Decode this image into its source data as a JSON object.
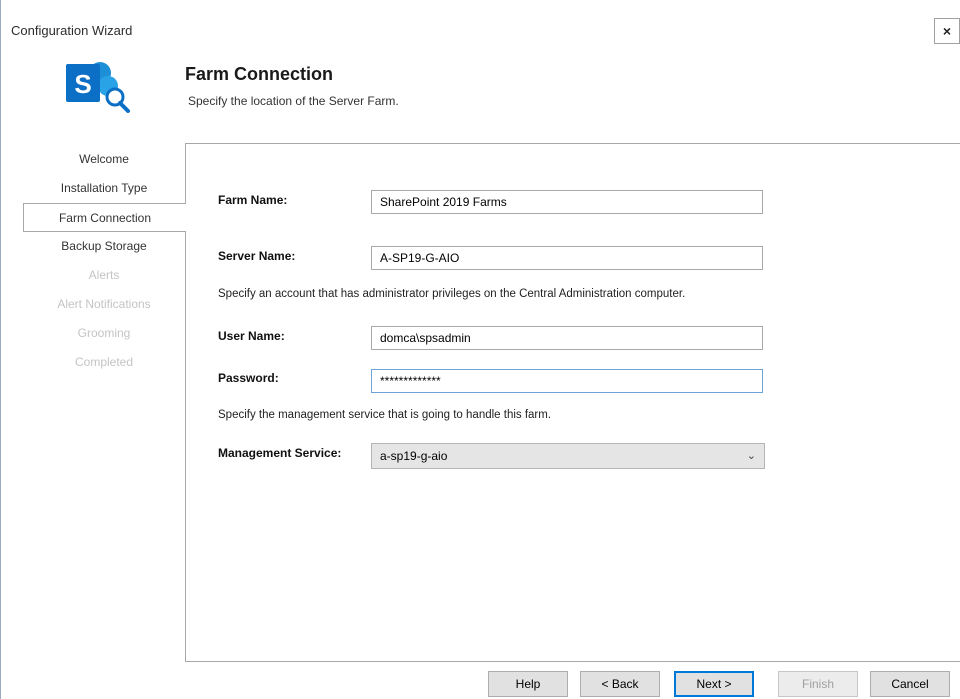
{
  "window": {
    "title": "Configuration Wizard",
    "close_glyph": "×"
  },
  "header": {
    "title": "Farm Connection",
    "subtitle": "Specify the location of the Server Farm.",
    "logo_icon": "sharepoint-search-logo-icon"
  },
  "nav": {
    "items": [
      {
        "label": "Welcome",
        "state": "normal"
      },
      {
        "label": "Installation Type",
        "state": "normal"
      },
      {
        "label": "Farm Connection",
        "state": "active"
      },
      {
        "label": "Backup Storage",
        "state": "normal"
      },
      {
        "label": "Alerts",
        "state": "disabled"
      },
      {
        "label": "Alert Notifications",
        "state": "disabled"
      },
      {
        "label": "Grooming",
        "state": "disabled"
      },
      {
        "label": "Completed",
        "state": "disabled"
      }
    ]
  },
  "form": {
    "farm_name_label": "Farm Name:",
    "farm_name_value": "SharePoint 2019 Farms",
    "server_name_label": "Server Name:",
    "server_name_value": "A-SP19-G-AIO",
    "account_info": "Specify an account that has administrator privileges on the Central Administration computer.",
    "user_name_label": "User Name:",
    "user_name_value": "domca\\spsadmin",
    "password_label": "Password:",
    "password_value": "*************",
    "mgmt_info": "Specify the management service that is going to handle this farm.",
    "mgmt_label": "Management Service:",
    "mgmt_value": "a-sp19-g-aio"
  },
  "buttons": {
    "help": "Help",
    "back": "< Back",
    "next": "Next >",
    "finish": "Finish",
    "cancel": "Cancel"
  },
  "colors": {
    "sharepoint_blue": "#0b6fc6",
    "focus_border": "#6da3d6",
    "primary_button_border": "#0078d7"
  }
}
